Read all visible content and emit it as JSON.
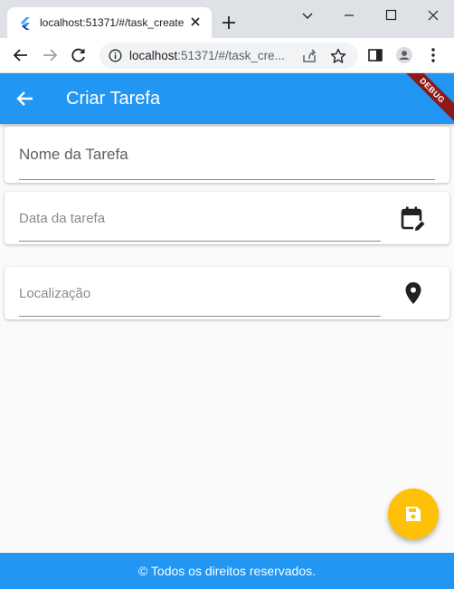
{
  "browser": {
    "tab_title": "localhost:51371/#/task_create",
    "url_host": "localhost",
    "url_rest": ":51371/#/task_cre..."
  },
  "app": {
    "title": "Criar Tarefa",
    "debug_banner": "DEBUG",
    "fields": [
      {
        "label": "Nome da Tarefa",
        "value": "",
        "icon": ""
      },
      {
        "label": "Data da tarefa",
        "value": "",
        "icon": "edit-calendar-icon"
      },
      {
        "label": "Localização",
        "value": "",
        "icon": "location-pin-icon"
      }
    ],
    "fab_icon": "save-icon",
    "footer_text": "© Todos os direitos reservados."
  },
  "colors": {
    "primary": "#2196f3",
    "fab": "#ffc107",
    "background": "#fafafa"
  }
}
